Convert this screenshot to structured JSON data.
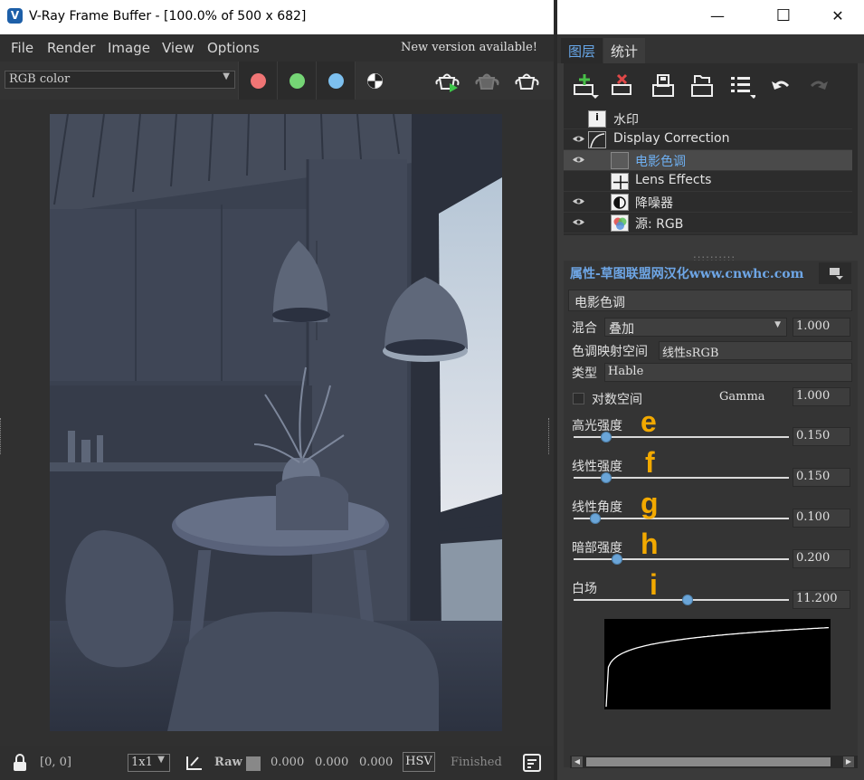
{
  "window": {
    "logo": "V",
    "title": "V-Ray Frame Buffer - [100.0% of 500 x 682]",
    "minimize_glyph": "—",
    "maximize_glyph": "☐",
    "close_glyph": "✕"
  },
  "menu": {
    "items": [
      "File",
      "Render",
      "Image",
      "View",
      "Options"
    ],
    "notice": "New version available!"
  },
  "toolbar": {
    "channel_select": "RGB color",
    "channel_dots": [
      "#f07575",
      "#75d575",
      "#7dc0ef"
    ]
  },
  "status": {
    "coords": "[0, 0]",
    "sampling": "1x1",
    "raw_label": "Raw",
    "values": [
      "0.000",
      "0.000",
      "0.000"
    ],
    "color_mode": "HSV",
    "state": "Finished"
  },
  "panel": {
    "tabs": [
      "图层",
      "统计"
    ],
    "layers": [
      {
        "label": "水印",
        "icon": "info-icon",
        "visible": false,
        "indent": false,
        "selected": false
      },
      {
        "label": "Display Correction",
        "icon": "curve-icon",
        "visible": true,
        "indent": false,
        "selected": false
      },
      {
        "label": "电影色调",
        "icon": "filmic-icon",
        "visible": true,
        "indent": true,
        "selected": true
      },
      {
        "label": "Lens Effects",
        "icon": "lens-icon",
        "visible": false,
        "indent": true,
        "selected": false
      },
      {
        "label": "降噪器",
        "icon": "denoiser-icon",
        "visible": true,
        "indent": true,
        "selected": false
      },
      {
        "label": "源: RGB",
        "icon": "rgb-icon",
        "visible": true,
        "indent": true,
        "selected": false
      }
    ],
    "properties_header": "属性-草图联盟网汉化www.cnwhc.com",
    "layer_name": "电影色调",
    "blend_label": "混合",
    "blend_mode": "叠加",
    "blend_value": "1.000",
    "tonemap_label": "色调映射空间",
    "tonemap_value": "线性sRGB",
    "type_label": "类型",
    "type_value": "Hable",
    "log_label": "对数空间",
    "gamma_label": "Gamma",
    "gamma_value": "1.000",
    "sliders": [
      {
        "label": "高光强度",
        "value": "0.150",
        "letter": "e",
        "position": 0.15
      },
      {
        "label": "线性强度",
        "value": "0.150",
        "letter": "f",
        "position": 0.15
      },
      {
        "label": "线性角度",
        "value": "0.100",
        "letter": "g",
        "position": 0.1
      },
      {
        "label": "暗部强度",
        "value": "0.200",
        "letter": "h",
        "position": 0.2
      },
      {
        "label": "白场",
        "value": "11.200",
        "letter": "i",
        "position": 0.53
      }
    ],
    "accent_color": "#6ea6e6",
    "annotation_color": "#f2a900"
  }
}
